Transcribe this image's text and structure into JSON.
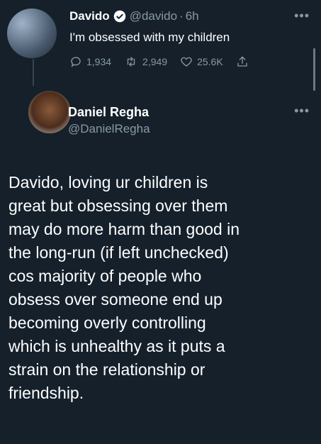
{
  "tweet1": {
    "name": "Davido",
    "handle": "@davido",
    "separator": "·",
    "time": "6h",
    "more": "•••",
    "text": "I'm obsessed with my children",
    "replies": "1,934",
    "retweets": "2,949",
    "likes": "25.6K"
  },
  "tweet2": {
    "name": "Daniel Regha",
    "handle": "@DanielRegha",
    "more": "•••",
    "lines": [
      "Davido, loving ur children is",
      "great but obsessing over them",
      "may do more harm than good in",
      "the long-run (if left unchecked)",
      "cos majority of people who",
      "obsess over someone end up",
      "becoming overly controlling",
      "which is unhealthy as it puts a",
      "strain on the relationship or",
      "friendship."
    ]
  },
  "colors": {
    "background": "#15202b",
    "muted": "#8899a6",
    "verified": "#1d9bf0"
  }
}
